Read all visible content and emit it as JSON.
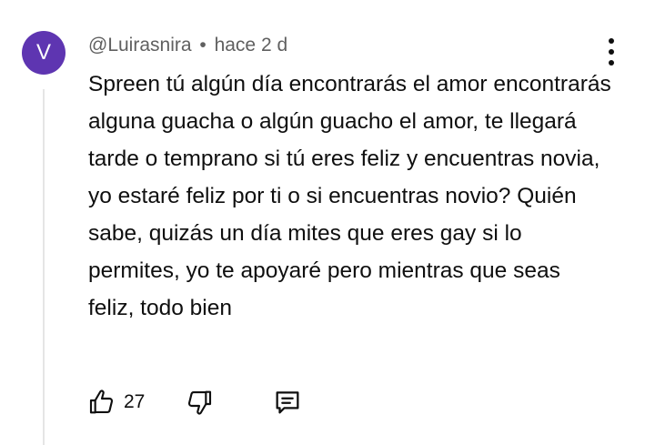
{
  "comment": {
    "avatar_letter": "V",
    "avatar_color": "#5e35b1",
    "author": "@Luirasnira",
    "separator": "•",
    "time": "hace 2 d",
    "text": "Spreen tú algún día encontrarás el amor encontrarás alguna guacha o algún guacho el amor, te llegará tarde o temprano si tú eres feliz y encuentras novia, yo estaré feliz por ti o si encuentras novio? Quién sabe, quizás un día mites que eres gay si lo permites, yo te apoyaré pero mientras que seas feliz, todo bien",
    "like_count": "27",
    "icons": {
      "more": "more-vert-icon",
      "like": "thumb-up-icon",
      "dislike": "thumb-down-icon",
      "reply": "reply-comment-icon"
    }
  }
}
